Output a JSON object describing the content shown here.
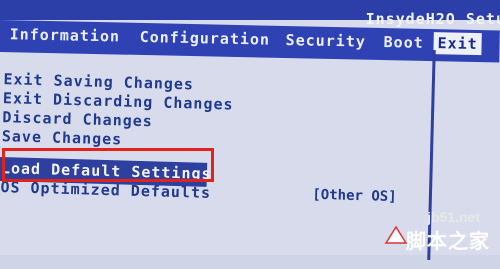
{
  "bios": {
    "vendor": "InsydeH2O Setu"
  },
  "menu": {
    "tabs": [
      {
        "label": "Information"
      },
      {
        "label": "Configuration"
      },
      {
        "label": "Security"
      },
      {
        "label": "Boot"
      },
      {
        "label": "Exit"
      }
    ],
    "active_tab": "Exit"
  },
  "exit_menu": {
    "items": [
      {
        "label": "Exit Saving Changes"
      },
      {
        "label": "Exit Discarding Changes"
      },
      {
        "label": "Discard Changes"
      },
      {
        "label": "Save Changes"
      },
      {
        "label": "Load Default Settings"
      },
      {
        "label": "OS Optimized Defaults",
        "value": "[Other OS]"
      }
    ],
    "selected_item": "Load Default Settings"
  },
  "watermark": {
    "site": "jb51.net",
    "name": "脚本之家"
  },
  "colors": {
    "bios_blue": "#2e42b4",
    "panel_bg": "#d7dbeb",
    "text_blue": "#1f3a8f",
    "annotation_red": "#e2231a"
  }
}
